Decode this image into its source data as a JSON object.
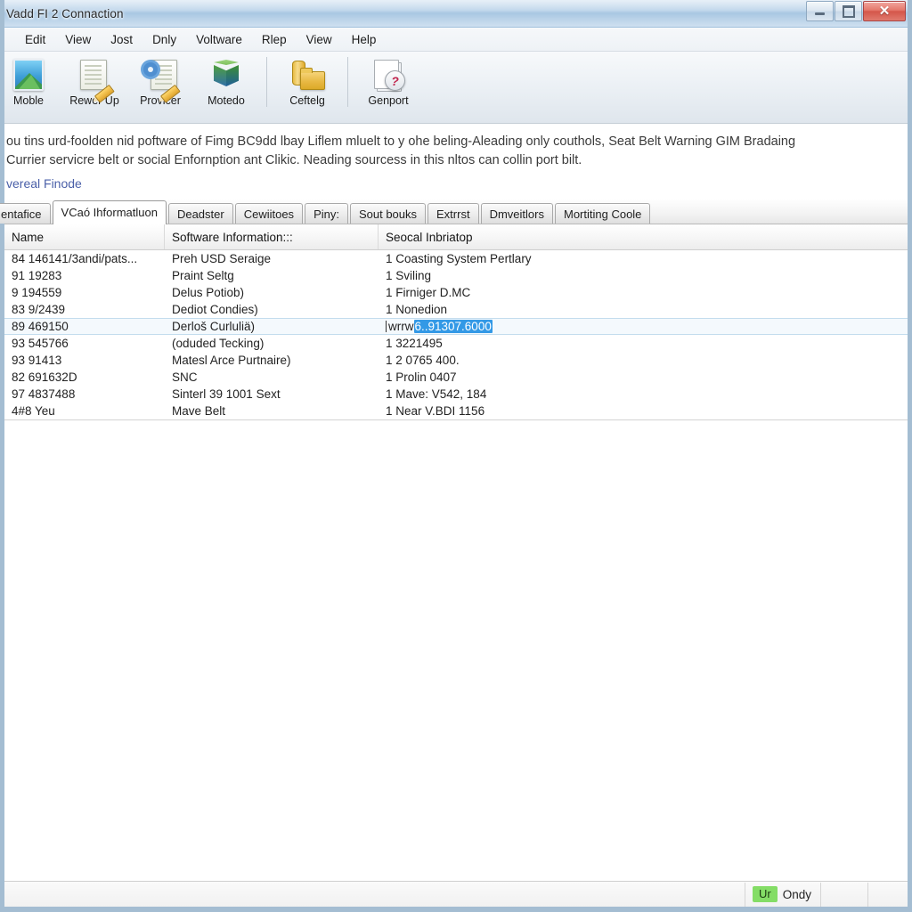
{
  "window": {
    "title": "Vadd FI 2 Connaction",
    "controls": {
      "minimize": "minimize",
      "maximize": "maximize",
      "close": "✕"
    }
  },
  "menubar": {
    "items": [
      {
        "label": "Edit"
      },
      {
        "label": "View"
      },
      {
        "label": "Jost"
      },
      {
        "label": "Dnly"
      },
      {
        "label": "Voltware"
      },
      {
        "label": "Rlep"
      },
      {
        "label": "View"
      },
      {
        "label": "Help"
      }
    ]
  },
  "toolbar": {
    "buttons": [
      {
        "label": "Moble",
        "icon": "photo-icon"
      },
      {
        "label": "Rewer Up",
        "icon": "document-pencil-icon"
      },
      {
        "label": "Provicer",
        "icon": "settings-document-icon"
      },
      {
        "label": "Motedo",
        "icon": "cube-icon"
      },
      {
        "label": "Ceftelg",
        "icon": "folder-icon"
      },
      {
        "label": "Genport",
        "icon": "help-pages-icon"
      }
    ]
  },
  "description": {
    "line1": "ou tins urd-foolden nid poftware of Fimg  BC9dd lbay Liflem mluelt to y ohe beling-Aleading only couthols, Seat Belt Warning GIM Bradaing",
    "line2": "Currier servicre belt or social Enfornption ant Clikic. Neading sourcess in this nltos can collin port bilt.",
    "link": "vereal Finode"
  },
  "tabs": [
    {
      "label": "entafice",
      "active": false
    },
    {
      "label": "VCaó Ihformatluon",
      "active": true
    },
    {
      "label": "Deadster",
      "active": false
    },
    {
      "label": "Cewiitoes",
      "active": false
    },
    {
      "label": "Piny:",
      "active": false
    },
    {
      "label": "Sout bouks",
      "active": false
    },
    {
      "label": "Extrrst",
      "active": false
    },
    {
      "label": "Dmveitlors",
      "active": false
    },
    {
      "label": "Mortiting Coole",
      "active": false
    }
  ],
  "table": {
    "columns": [
      "Name",
      "Software Information:::",
      "Seocal Inbriatop"
    ],
    "rows": [
      {
        "name": "84 146141/3andi/pats...",
        "software": "Preh USD Seraige",
        "info": "1 Coasting System Pertlary",
        "selected": false
      },
      {
        "name": "91 19283",
        "software": "Praint Seltg",
        "info": "1 Sviling",
        "selected": false
      },
      {
        "name": "9 194559",
        "software": "Delus Potiob)",
        "info": "1 Firniger D.MC",
        "selected": false
      },
      {
        "name": "83 9/2439",
        "software": "Dediot Condies)",
        "info": "1 Nonedion",
        "selected": false
      },
      {
        "name": "89 469150",
        "software": "Derloš Curluliä)",
        "info_prefix": "wrrw",
        "info_selected": "6..91307.6000",
        "info": "wrrw 6..91307.6000",
        "selected": true
      },
      {
        "name": "93 545766",
        "software": "(oduded Tecking)",
        "info": "1 3221495",
        "selected": false
      },
      {
        "name": "93 91413",
        "software": "Matesl Arce Purtnaire)",
        "info": "1 2 0765 400.",
        "selected": false
      },
      {
        "name": "82 691632D",
        "software": "SNC",
        "info": "1 Prolin 0407",
        "selected": false
      },
      {
        "name": "97 4837488",
        "software": "Sinterl 39 1001 Sext",
        "info": "1 Mave: V542, 184",
        "selected": false
      },
      {
        "name": "4#8 Yeu",
        "software": "Mave Belt",
        "info": "1 Near V.BDI 1156",
        "selected": false
      }
    ]
  },
  "statusbar": {
    "badge": "Ur",
    "text": "Ondy"
  },
  "colors": {
    "accent": "#3399e6",
    "badge_green": "#84dd66",
    "link": "#4a5fa8",
    "titlebar": "#b9d2e8"
  }
}
